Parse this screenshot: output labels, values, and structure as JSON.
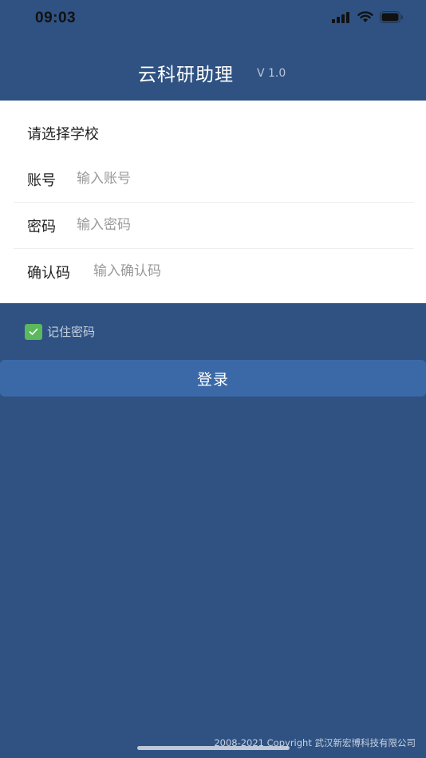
{
  "status_bar": {
    "time": "09:03",
    "icons": [
      "signal-icon",
      "wifi-icon",
      "battery-icon"
    ]
  },
  "header": {
    "title": "云科研助理",
    "version": "V 1.0"
  },
  "form": {
    "school_select": "请选择学校",
    "account": {
      "label": "账号",
      "placeholder": "输入账号",
      "value": ""
    },
    "password": {
      "label": "密码",
      "placeholder": "输入密码",
      "value": ""
    },
    "captcha": {
      "label": "确认码",
      "placeholder": "输入确认码",
      "value": ""
    }
  },
  "remember_password": {
    "label": "记住密码",
    "checked": true
  },
  "login_button": {
    "label": "登录"
  },
  "footer": {
    "copyright": "2008-2021 Copyright 武汉新宏博科技有限公司"
  },
  "colors": {
    "background": "#2f5282",
    "button": "#3b69a8",
    "checkbox": "#5cb85c"
  }
}
